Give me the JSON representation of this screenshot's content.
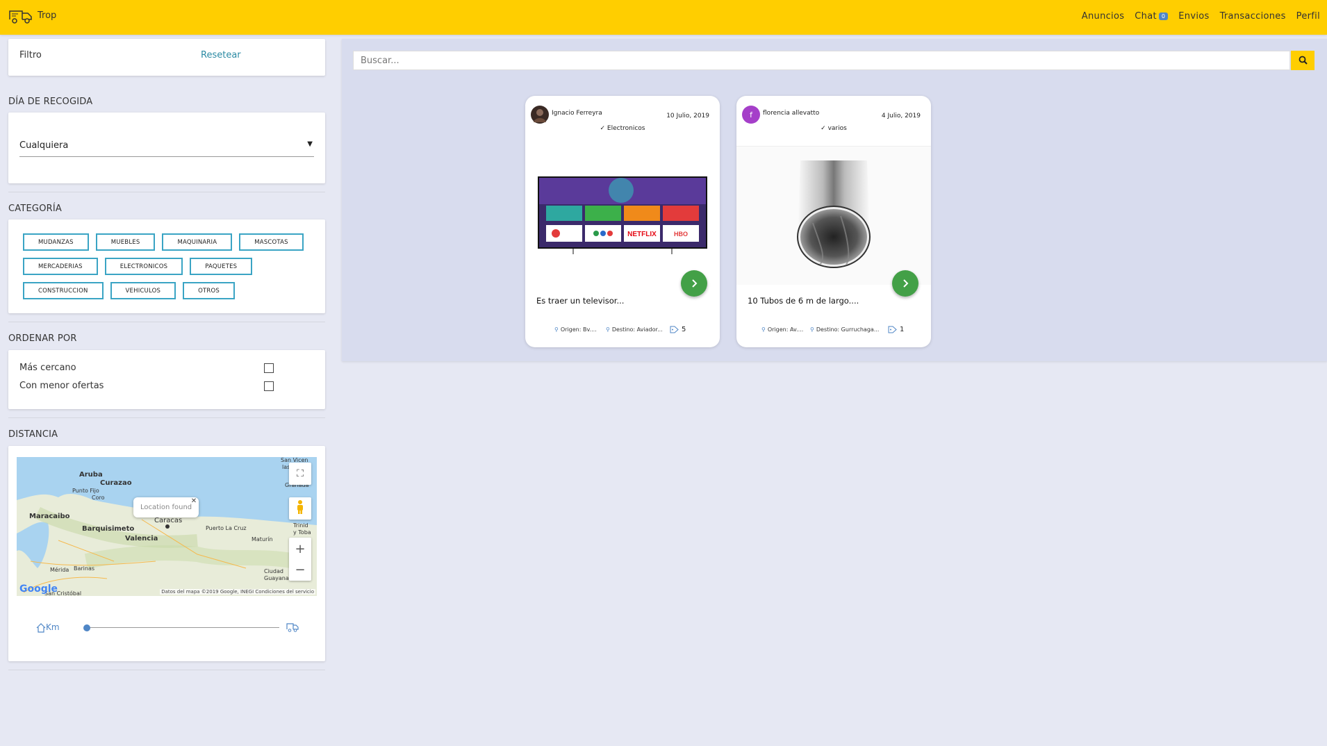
{
  "navbar": {
    "brand": "Trop",
    "links": {
      "anuncios": "Anuncios",
      "chat": "Chat",
      "chat_count": "0",
      "envios": "Envios",
      "transacciones": "Transacciones",
      "perfil": "Perfil"
    },
    "accent_color": "#ffce00"
  },
  "sidebar": {
    "filter_title": "Filtro",
    "reset_label": "Resetear",
    "pickup": {
      "heading": "DÍA DE RECOGIDA",
      "selected": "Cualquiera"
    },
    "category": {
      "heading": "CATEGORÍA",
      "row1": [
        "MUDANZAS",
        "MUEBLES",
        "MAQUINARIA",
        "MASCOTAS"
      ],
      "row2": [
        "MERCADERIAS",
        "ELECTRONICOS",
        "PAQUETES"
      ],
      "row3": [
        "CONSTRUCCION",
        "VEHICULOS",
        "OTROS"
      ]
    },
    "order": {
      "heading": "ORDENAR POR",
      "option1": "Más cercano",
      "option2": "Con menor ofertas"
    },
    "distance": {
      "heading": "DISTANCIA",
      "km_label": "Km",
      "map": {
        "popup": "Location found",
        "credits": "Datos del mapa ©2019 Google, INEGI    Condiciones del servicio",
        "logo": "Google",
        "places": {
          "aruba": "Aruba",
          "curazao": "Curazao",
          "punto_fijo": "Punto Fijo",
          "coro": "Coro",
          "maracaibo": "Maracaibo",
          "barquisimeto": "Barquisimeto",
          "valencia": "Valencia",
          "caracas": "Caracas",
          "puerto_la_cruz": "Puerto La Cruz",
          "maturin": "Maturín",
          "merida": "Mérida",
          "barinas": "Barinas",
          "ciudad_guayana": "Ciudad Guayana",
          "san_vicente": "San Vicen",
          "las_granadinas": "las Gra",
          "granada": "Granada",
          "trinidad": "Trinid",
          "tobago": "y Toba",
          "san_cristobal": "San Cristóbal"
        }
      }
    }
  },
  "main": {
    "search_placeholder": "Buscar...",
    "cards": [
      {
        "user": "Ignacio Ferreyra",
        "date": "10 Julio, 2019",
        "category": "Electronicos",
        "title": "Es traer un televisor...",
        "origin": "Origen: Bv....",
        "destination": "Destino: Aviador...",
        "offers": "5"
      },
      {
        "user": "florencia allevatto",
        "avatar_letter": "f",
        "date": "4 Julio, 2019",
        "category": "varios",
        "title": "10 Tubos de 6 m de largo....",
        "origin": "Origen: Av....",
        "destination": "Destino: Gurruchaga...",
        "offers": "1"
      }
    ],
    "tv_tiles": [
      "NETFLIX"
    ]
  }
}
